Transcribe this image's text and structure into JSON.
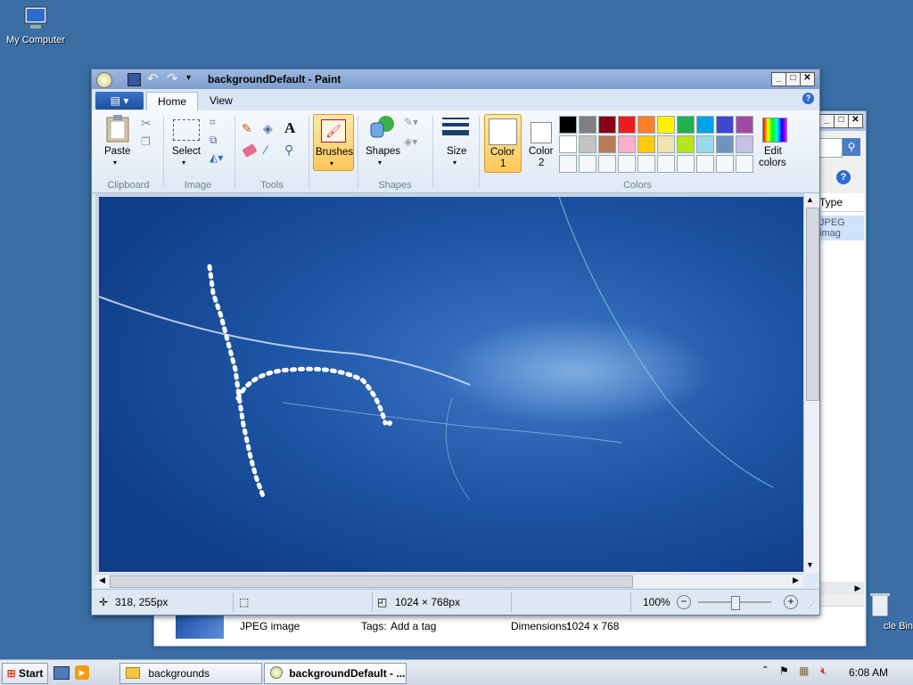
{
  "desktop": {
    "icons": [
      {
        "label": "My Computer"
      },
      {
        "label": "cle Bin"
      }
    ]
  },
  "explorer": {
    "column_type": "Type",
    "row_type": "JPEG imag",
    "details": {
      "type": "JPEG image",
      "tags_label": "Tags:",
      "tags_value": "Add a tag",
      "dims_label": "Dimensions:",
      "dims_value": "1024 x 768"
    }
  },
  "paint": {
    "title": "backgroundDefault - Paint",
    "tabs": [
      "Home",
      "View"
    ],
    "groups": {
      "clipboard": "Clipboard",
      "image": "Image",
      "tools": "Tools",
      "shapes": "Shapes",
      "colors": "Colors"
    },
    "buttons": {
      "paste": "Paste",
      "select": "Select",
      "brushes": "Brushes",
      "shapes": "Shapes",
      "size": "Size",
      "color1_a": "Color",
      "color1_b": "1",
      "color2_a": "Color",
      "color2_b": "2",
      "edit_a": "Edit",
      "edit_b": "colors"
    },
    "palette": [
      "#000000",
      "#7f7f7f",
      "#880015",
      "#ed1c24",
      "#ff7f27",
      "#fff200",
      "#22b14c",
      "#00a2e8",
      "#3f48cc",
      "#a349a4",
      "#ffffff",
      "#c3c3c3",
      "#b97a57",
      "#ffaec9",
      "#ffc90e",
      "#efe4b0",
      "#b5e61d",
      "#99d9ea",
      "#7092be",
      "#c8bfe7"
    ],
    "status": {
      "cursor_pos": "318, 255px",
      "image_size": "1024 × 768px",
      "zoom": "100%",
      "zoom_fraction": 0.5
    }
  },
  "taskbar": {
    "start": "Start",
    "items": [
      "backgrounds",
      "backgroundDefault - ..."
    ],
    "clock": "6:08 AM"
  }
}
